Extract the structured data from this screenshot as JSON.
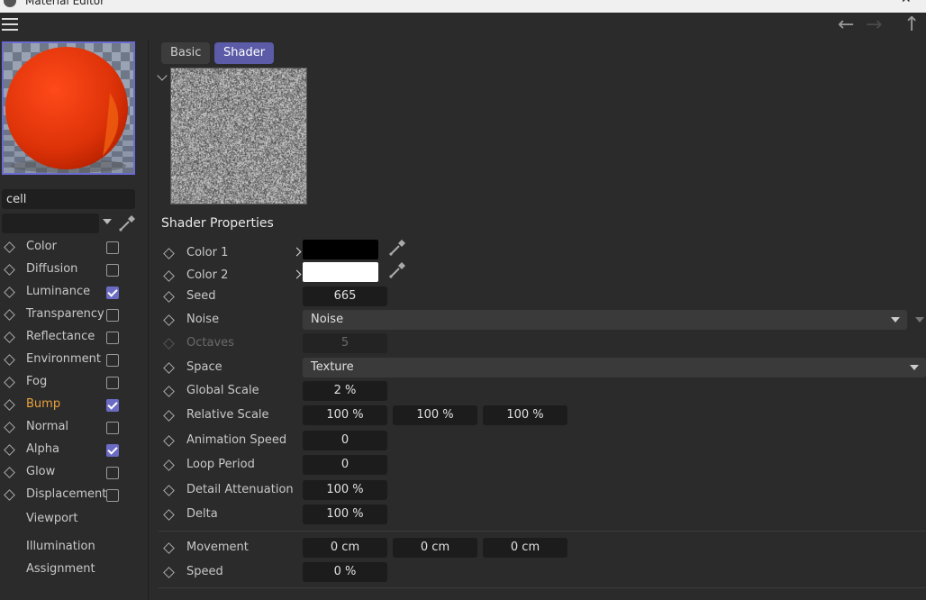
{
  "window": {
    "title": "Material Editor"
  },
  "sidebar": {
    "material_name": "cell",
    "channels": [
      {
        "label": "Color",
        "checked": false
      },
      {
        "label": "Diffusion",
        "checked": false
      },
      {
        "label": "Luminance",
        "checked": true
      },
      {
        "label": "Transparency",
        "checked": false
      },
      {
        "label": "Reflectance",
        "checked": false
      },
      {
        "label": "Environment",
        "checked": false
      },
      {
        "label": "Fog",
        "checked": false
      },
      {
        "label": "Bump",
        "checked": true,
        "active": true
      },
      {
        "label": "Normal",
        "checked": false
      },
      {
        "label": "Alpha",
        "checked": true
      },
      {
        "label": "Glow",
        "checked": false
      },
      {
        "label": "Displacement",
        "checked": false
      }
    ],
    "extra_items": [
      "Viewport",
      "Illumination",
      "Assignment"
    ]
  },
  "tabs": [
    {
      "label": "Basic",
      "selected": false
    },
    {
      "label": "Shader",
      "selected": true
    }
  ],
  "shader": {
    "section_title": "Shader Properties",
    "color1": {
      "label": "Color 1",
      "value": "#000000"
    },
    "color2": {
      "label": "Color 2",
      "value": "#ffffff"
    },
    "seed": {
      "label": "Seed",
      "value": "665"
    },
    "noise": {
      "label": "Noise",
      "value": "Noise"
    },
    "octaves": {
      "label": "Octaves",
      "value": "5"
    },
    "space": {
      "label": "Space",
      "value": "Texture"
    },
    "global_scale": {
      "label": "Global Scale",
      "value": "2 %"
    },
    "relative_scale": {
      "label": "Relative Scale",
      "values": [
        "100 %",
        "100 %",
        "100 %"
      ]
    },
    "animation_speed": {
      "label": "Animation Speed",
      "value": "0"
    },
    "loop_period": {
      "label": "Loop Period",
      "value": "0"
    },
    "detail_attenuation": {
      "label": "Detail Attenuation",
      "value": "100 %"
    },
    "delta": {
      "label": "Delta",
      "value": "100 %"
    },
    "movement": {
      "label": "Movement",
      "values": [
        "0 cm",
        "0 cm",
        "0 cm"
      ]
    },
    "speed": {
      "label": "Speed",
      "value": "0 %"
    }
  },
  "colors": {
    "accent": "#5b5ba8",
    "active_channel": "#e8a13c",
    "preview_sphere": "#e03a0a"
  }
}
